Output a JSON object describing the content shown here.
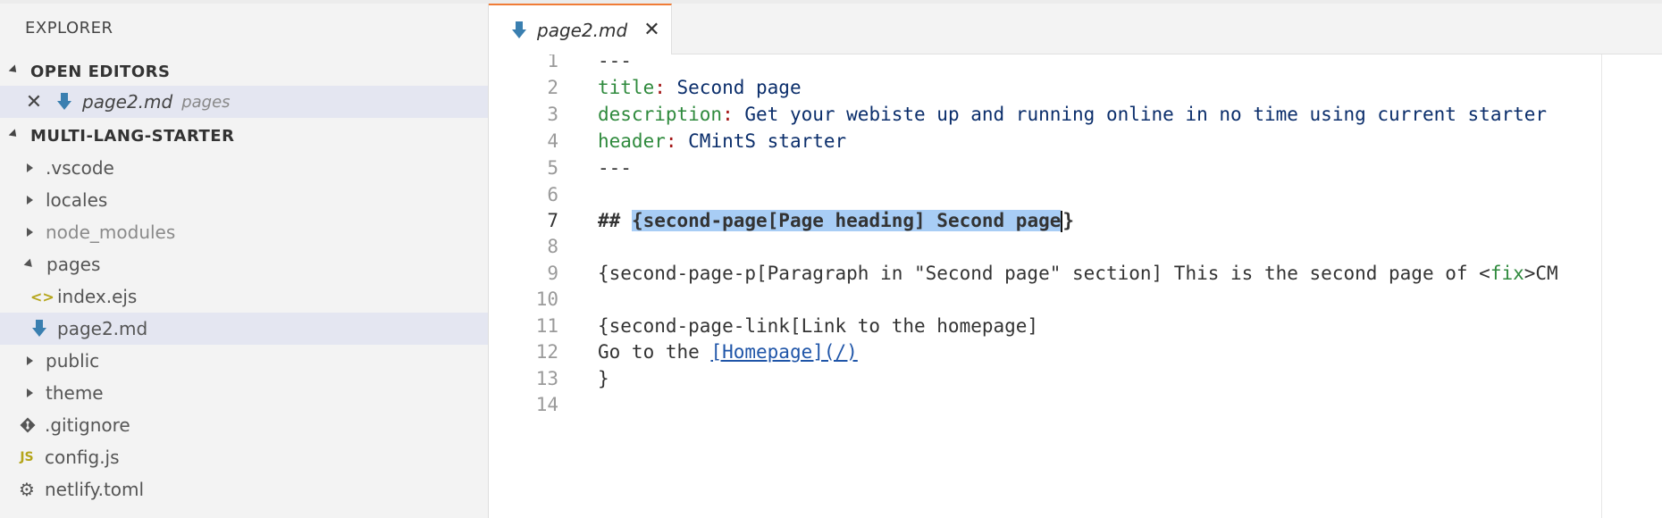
{
  "sidebar": {
    "title": "EXPLORER",
    "open_editors": {
      "header": "OPEN EDITORS",
      "items": [
        {
          "name": "page2.md",
          "dir": "pages",
          "icon": "markdown-icon"
        }
      ]
    },
    "project": {
      "header": "MULTI-LANG-STARTER",
      "items": [
        {
          "name": ".vscode",
          "type": "folder",
          "expanded": false
        },
        {
          "name": "locales",
          "type": "folder",
          "expanded": false
        },
        {
          "name": "node_modules",
          "type": "folder",
          "expanded": false
        },
        {
          "name": "pages",
          "type": "folder",
          "expanded": true
        },
        {
          "name": "index.ejs",
          "type": "file",
          "icon": "ejs-code-icon"
        },
        {
          "name": "page2.md",
          "type": "file",
          "icon": "markdown-icon",
          "selected": true
        },
        {
          "name": "public",
          "type": "folder",
          "expanded": false
        },
        {
          "name": "theme",
          "type": "folder",
          "expanded": false
        },
        {
          "name": ".gitignore",
          "type": "file",
          "icon": "git-icon"
        },
        {
          "name": "config.js",
          "type": "file",
          "icon": "js-icon"
        },
        {
          "name": "netlify.toml",
          "type": "file",
          "icon": "gear-icon"
        }
      ]
    }
  },
  "tabs": [
    {
      "label": "page2.md",
      "active": true
    }
  ],
  "editor": {
    "active_line": 7,
    "lines": [
      {
        "n": "1",
        "text": "---"
      },
      {
        "n": "2",
        "key": "title",
        "colon": ":",
        "value": " Second page"
      },
      {
        "n": "3",
        "key": "description",
        "colon": ":",
        "value": " Get your webiste up and running online in no time using current starter"
      },
      {
        "n": "4",
        "key": "header",
        "colon": ":",
        "value": " CMintS starter"
      },
      {
        "n": "5",
        "text": "---"
      },
      {
        "n": "6",
        "text": ""
      },
      {
        "n": "7",
        "hash": "## ",
        "selected": "{second-page[Page heading] Second page",
        "after": "}"
      },
      {
        "n": "8",
        "text": ""
      },
      {
        "n": "9",
        "pre": "{second-page-p[Paragraph in \"Second page\" section] This is the second page of <",
        "tag": "fix",
        "post": ">CM"
      },
      {
        "n": "10",
        "text": ""
      },
      {
        "n": "11",
        "text": "{second-page-link[Link to the homepage]"
      },
      {
        "n": "12",
        "pre": "Go to the ",
        "link": "[Homepage](/)"
      },
      {
        "n": "13",
        "text": "}"
      },
      {
        "n": "14",
        "text": ""
      }
    ]
  },
  "colors": {
    "accent_tab": "#f07c36",
    "selection": "#a8cdf5",
    "yaml_key": "#2f8a3d",
    "link": "#1f55a8"
  }
}
